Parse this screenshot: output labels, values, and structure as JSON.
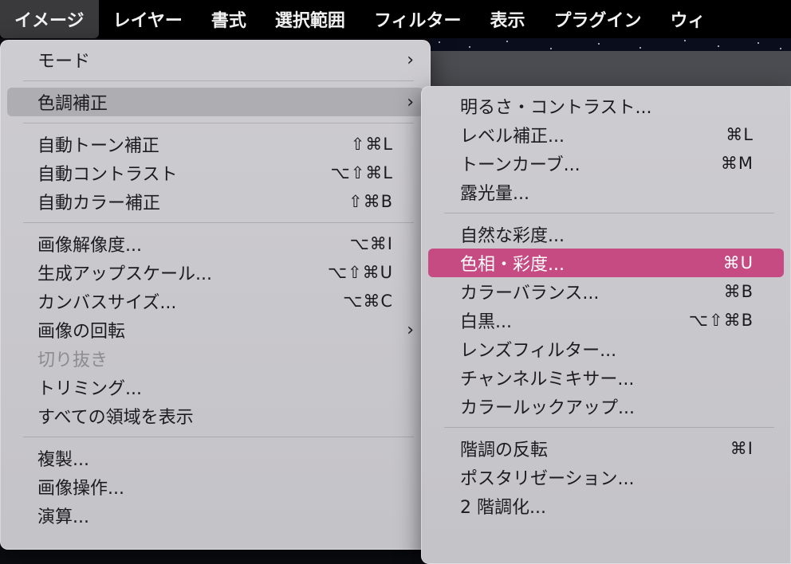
{
  "menubar": {
    "items": [
      {
        "label": "イメージ",
        "active": true
      },
      {
        "label": "レイヤー"
      },
      {
        "label": "書式"
      },
      {
        "label": "選択範囲"
      },
      {
        "label": "フィルター"
      },
      {
        "label": "表示"
      },
      {
        "label": "プラグイン"
      },
      {
        "label": "ウィ"
      }
    ]
  },
  "image_menu": {
    "mode": {
      "label": "モード",
      "arrow": "›"
    },
    "adjustments": {
      "label": "色調補正",
      "arrow": "›"
    },
    "auto_tone": {
      "label": "自動トーン補正",
      "shortcut": "⇧⌘L"
    },
    "auto_contrast": {
      "label": "自動コントラスト",
      "shortcut": "⌥⇧⌘L"
    },
    "auto_color": {
      "label": "自動カラー補正",
      "shortcut": "⇧⌘B"
    },
    "image_size": {
      "label": "画像解像度...",
      "shortcut": "⌥⌘I"
    },
    "generative_upscale": {
      "label": "生成アップスケール...",
      "shortcut": "⌥⇧⌘U"
    },
    "canvas_size": {
      "label": "カンバスサイズ...",
      "shortcut": "⌥⌘C"
    },
    "rotation": {
      "label": "画像の回転",
      "arrow": "›"
    },
    "crop": {
      "label": "切り抜き"
    },
    "trim": {
      "label": "トリミング..."
    },
    "reveal_all": {
      "label": "すべての領域を表示"
    },
    "duplicate": {
      "label": "複製..."
    },
    "apply_image": {
      "label": "画像操作..."
    },
    "calculations": {
      "label": "演算..."
    }
  },
  "adjustments_menu": {
    "brightness": {
      "label": "明るさ・コントラスト..."
    },
    "levels": {
      "label": "レベル補正...",
      "shortcut": "⌘L"
    },
    "curves": {
      "label": "トーンカーブ...",
      "shortcut": "⌘M"
    },
    "exposure": {
      "label": "露光量..."
    },
    "vibrance": {
      "label": "自然な彩度..."
    },
    "hue_saturation": {
      "label": "色相・彩度...",
      "shortcut": "⌘U"
    },
    "color_balance": {
      "label": "カラーバランス...",
      "shortcut": "⌘B"
    },
    "black_white": {
      "label": "白黒...",
      "shortcut": "⌥⇧⌘B"
    },
    "photo_filter": {
      "label": "レンズフィルター..."
    },
    "channel_mixer": {
      "label": "チャンネルミキサー..."
    },
    "color_lookup": {
      "label": "カラールックアップ..."
    },
    "invert": {
      "label": "階調の反転",
      "shortcut": "⌘I"
    },
    "posterize": {
      "label": "ポスタリゼーション..."
    },
    "threshold": {
      "label": "2 階調化..."
    }
  },
  "colors": {
    "highlight": "#c54b82",
    "hover": "#aeadb2",
    "menubar": "#000000"
  }
}
